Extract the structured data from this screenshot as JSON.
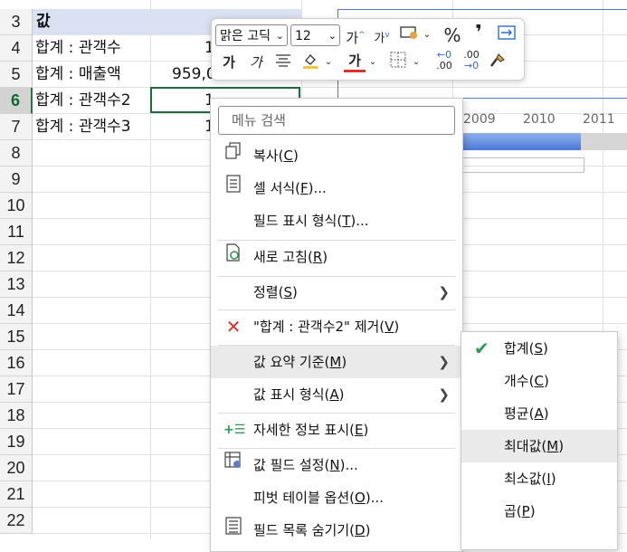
{
  "sheet": {
    "rows": [
      "3",
      "4",
      "5",
      "6",
      "7",
      "8",
      "9",
      "10",
      "11",
      "12",
      "13",
      "14",
      "15",
      "16",
      "17",
      "18",
      "19",
      "20",
      "21",
      "22"
    ],
    "selected_row": "6",
    "cells": {
      "a3": "값",
      "a4": "합계 : 관객수",
      "b4": "1",
      "a5": "합계 : 매출액",
      "b5": "959,0",
      "a6": "합계 : 관객수2",
      "b6": "1",
      "a7": "합계 : 관객수3",
      "b7": "1"
    },
    "chart_years": [
      "2009",
      "2010",
      "2011"
    ]
  },
  "mini_toolbar": {
    "font_name": "맑은 고딕",
    "font_size": "12",
    "grow_font": "가",
    "shrink_font": "가",
    "percent": "%",
    "comma": "❜",
    "bold": "가",
    "italic": "가",
    "font_color": "가",
    "inc_decimal": ".00",
    "dec_decimal": ".00"
  },
  "context_menu": {
    "search_placeholder": "메뉴 검색",
    "items": [
      {
        "label": "복사(",
        "key": "C",
        "tail": ")"
      },
      {
        "label": "셀 서식(",
        "key": "F",
        "tail": ")..."
      },
      {
        "label": "필드 표시 형식(",
        "key": "T",
        "tail": ")..."
      },
      {
        "label": "새로 고침(",
        "key": "R",
        "tail": ")"
      },
      {
        "label": "정렬(",
        "key": "S",
        "tail": ")"
      },
      {
        "label": "\"합계 : 관객수2\" 제거(",
        "key": "V",
        "tail": ")"
      },
      {
        "label": "값 요약 기준(",
        "key": "M",
        "tail": ")"
      },
      {
        "label": "값 표시 형식(",
        "key": "A",
        "tail": ")"
      },
      {
        "label": "자세한 정보 표시(",
        "key": "E",
        "tail": ")"
      },
      {
        "label": "값 필드 설정(",
        "key": "N",
        "tail": ")..."
      },
      {
        "label": "피벗 테이블 옵션(",
        "key": "O",
        "tail": ")..."
      },
      {
        "label": "필드 목록 숨기기(",
        "key": "D",
        "tail": ")"
      }
    ]
  },
  "submenu": {
    "items": [
      {
        "label": "합계(",
        "key": "S",
        "tail": ")"
      },
      {
        "label": "개수(",
        "key": "C",
        "tail": ")"
      },
      {
        "label": "평균(",
        "key": "A",
        "tail": ")"
      },
      {
        "label": "최대값(",
        "key": "M",
        "tail": ")"
      },
      {
        "label": "최소값(",
        "key": "I",
        "tail": ")"
      },
      {
        "label": "곱(",
        "key": "P",
        "tail": ")"
      }
    ]
  },
  "colors": {
    "accent_green": "#2f9a4e",
    "remove_red": "#d9342b",
    "chart_blue": "#4a78d6"
  }
}
